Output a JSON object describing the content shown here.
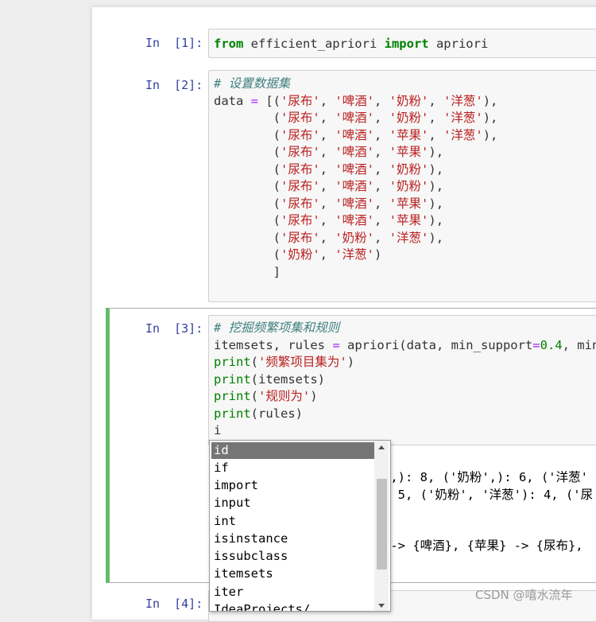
{
  "cells": [
    {
      "prompt": "In  [1]:",
      "lines": [
        [
          {
            "t": "from",
            "c": "kw"
          },
          {
            "t": " efficient_apriori ",
            "c": ""
          },
          {
            "t": "import",
            "c": "kw"
          },
          {
            "t": " apriori",
            "c": ""
          }
        ]
      ]
    },
    {
      "prompt": "In  [2]:",
      "lines": [
        [
          {
            "t": "# 设置数据集",
            "c": "cm"
          }
        ],
        [
          {
            "t": "data ",
            "c": ""
          },
          {
            "t": "=",
            "c": "op"
          },
          {
            "t": " [(",
            "c": ""
          },
          {
            "t": "'尿布'",
            "c": "st"
          },
          {
            "t": ", ",
            "c": ""
          },
          {
            "t": "'啤酒'",
            "c": "st"
          },
          {
            "t": ", ",
            "c": ""
          },
          {
            "t": "'奶粉'",
            "c": "st"
          },
          {
            "t": ", ",
            "c": ""
          },
          {
            "t": "'洋葱'",
            "c": "st"
          },
          {
            "t": "),",
            "c": ""
          }
        ],
        [
          {
            "t": "        (",
            "c": ""
          },
          {
            "t": "'尿布'",
            "c": "st"
          },
          {
            "t": ", ",
            "c": ""
          },
          {
            "t": "'啤酒'",
            "c": "st"
          },
          {
            "t": ", ",
            "c": ""
          },
          {
            "t": "'奶粉'",
            "c": "st"
          },
          {
            "t": ", ",
            "c": ""
          },
          {
            "t": "'洋葱'",
            "c": "st"
          },
          {
            "t": "),",
            "c": ""
          }
        ],
        [
          {
            "t": "        (",
            "c": ""
          },
          {
            "t": "'尿布'",
            "c": "st"
          },
          {
            "t": ", ",
            "c": ""
          },
          {
            "t": "'啤酒'",
            "c": "st"
          },
          {
            "t": ", ",
            "c": ""
          },
          {
            "t": "'苹果'",
            "c": "st"
          },
          {
            "t": ", ",
            "c": ""
          },
          {
            "t": "'洋葱'",
            "c": "st"
          },
          {
            "t": "),",
            "c": ""
          }
        ],
        [
          {
            "t": "        (",
            "c": ""
          },
          {
            "t": "'尿布'",
            "c": "st"
          },
          {
            "t": ", ",
            "c": ""
          },
          {
            "t": "'啤酒'",
            "c": "st"
          },
          {
            "t": ", ",
            "c": ""
          },
          {
            "t": "'苹果'",
            "c": "st"
          },
          {
            "t": "),",
            "c": ""
          }
        ],
        [
          {
            "t": "        (",
            "c": ""
          },
          {
            "t": "'尿布'",
            "c": "st"
          },
          {
            "t": ", ",
            "c": ""
          },
          {
            "t": "'啤酒'",
            "c": "st"
          },
          {
            "t": ", ",
            "c": ""
          },
          {
            "t": "'奶粉'",
            "c": "st"
          },
          {
            "t": "),",
            "c": ""
          }
        ],
        [
          {
            "t": "        (",
            "c": ""
          },
          {
            "t": "'尿布'",
            "c": "st"
          },
          {
            "t": ", ",
            "c": ""
          },
          {
            "t": "'啤酒'",
            "c": "st"
          },
          {
            "t": ", ",
            "c": ""
          },
          {
            "t": "'奶粉'",
            "c": "st"
          },
          {
            "t": "),",
            "c": ""
          }
        ],
        [
          {
            "t": "        (",
            "c": ""
          },
          {
            "t": "'尿布'",
            "c": "st"
          },
          {
            "t": ", ",
            "c": ""
          },
          {
            "t": "'啤酒'",
            "c": "st"
          },
          {
            "t": ", ",
            "c": ""
          },
          {
            "t": "'苹果'",
            "c": "st"
          },
          {
            "t": "),",
            "c": ""
          }
        ],
        [
          {
            "t": "        (",
            "c": ""
          },
          {
            "t": "'尿布'",
            "c": "st"
          },
          {
            "t": ", ",
            "c": ""
          },
          {
            "t": "'啤酒'",
            "c": "st"
          },
          {
            "t": ", ",
            "c": ""
          },
          {
            "t": "'苹果'",
            "c": "st"
          },
          {
            "t": "),",
            "c": ""
          }
        ],
        [
          {
            "t": "        (",
            "c": ""
          },
          {
            "t": "'尿布'",
            "c": "st"
          },
          {
            "t": ", ",
            "c": ""
          },
          {
            "t": "'奶粉'",
            "c": "st"
          },
          {
            "t": ", ",
            "c": ""
          },
          {
            "t": "'洋葱'",
            "c": "st"
          },
          {
            "t": "),",
            "c": ""
          }
        ],
        [
          {
            "t": "        (",
            "c": ""
          },
          {
            "t": "'奶粉'",
            "c": "st"
          },
          {
            "t": ", ",
            "c": ""
          },
          {
            "t": "'洋葱'",
            "c": "st"
          },
          {
            "t": ")",
            "c": ""
          }
        ],
        [
          {
            "t": "        ]",
            "c": ""
          }
        ]
      ]
    },
    {
      "prompt": "In  [3]:",
      "lines": [
        [
          {
            "t": "# 挖掘频繁项集和规则",
            "c": "cm"
          }
        ],
        [
          {
            "t": "itemsets, rules ",
            "c": ""
          },
          {
            "t": "=",
            "c": "op"
          },
          {
            "t": " apriori(data, min_support",
            "c": ""
          },
          {
            "t": "=",
            "c": "op"
          },
          {
            "t": "0.4",
            "c": "nm"
          },
          {
            "t": ", min_c",
            "c": ""
          }
        ],
        [
          {
            "t": "print",
            "c": "bi"
          },
          {
            "t": "(",
            "c": ""
          },
          {
            "t": "'频繁项目集为'",
            "c": "st"
          },
          {
            "t": ")",
            "c": ""
          }
        ],
        [
          {
            "t": "print",
            "c": "bi"
          },
          {
            "t": "(itemsets)",
            "c": ""
          }
        ],
        [
          {
            "t": "print",
            "c": "bi"
          },
          {
            "t": "(",
            "c": ""
          },
          {
            "t": "'规则为'",
            "c": "st"
          },
          {
            "t": ")",
            "c": ""
          }
        ],
        [
          {
            "t": "print",
            "c": "bi"
          },
          {
            "t": "(rules)",
            "c": ""
          }
        ],
        [
          {
            "t": "i",
            "c": ""
          }
        ]
      ]
    },
    {
      "prompt": "In  [4]:",
      "lines": []
    }
  ],
  "output_fragments": {
    "line1": "',): 8, ('奶粉',): 6, ('洋葱'",
    "line2": ": 5, ('奶粉', '洋葱'): 4, ('尿",
    "line3": " -> {啤酒}, {苹果} -> {尿布},"
  },
  "completer": {
    "items": [
      "id",
      "if",
      "import",
      "input",
      "int",
      "isinstance",
      "issubclass",
      "itemsets",
      "iter",
      "IdeaProjects/"
    ],
    "selected": "id"
  },
  "watermark": "CSDN @嘻水流年",
  "colors": {
    "accent": "#66bb6a",
    "prompt": "#303f9f",
    "keyword": "#008000",
    "string": "#ba2121",
    "comment": "#408080"
  }
}
